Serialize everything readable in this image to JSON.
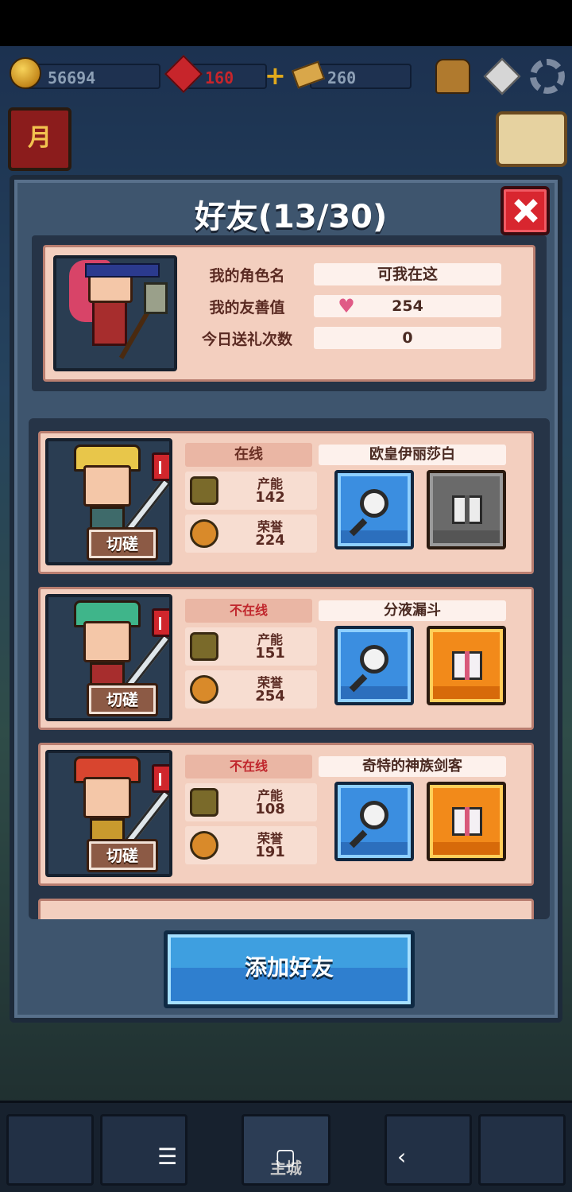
{
  "resources": {
    "gold": "56694",
    "gems": "160",
    "tickets": "260"
  },
  "dialog": {
    "title": "好友(13/30)"
  },
  "my_info": {
    "rows": [
      {
        "label": "我的角色名",
        "value": "可我在这"
      },
      {
        "label": "我的友善值",
        "value": "254"
      },
      {
        "label": "今日送礼次数",
        "value": "0"
      }
    ]
  },
  "friends": [
    {
      "status": "在线",
      "name": "欧皇伊丽莎白",
      "power_label": "产能",
      "power": "142",
      "honor_label": "荣誉",
      "honor": "224",
      "spar": "切磋",
      "gift_enabled": false
    },
    {
      "status": "不在线",
      "name": "分液漏斗",
      "power_label": "产能",
      "power": "151",
      "honor_label": "荣誉",
      "honor": "254",
      "spar": "切磋",
      "gift_enabled": true
    },
    {
      "status": "不在线",
      "name": "奇特的神族剑客",
      "power_label": "产能",
      "power": "108",
      "honor_label": "荣誉",
      "honor": "191",
      "spar": "切磋",
      "gift_enabled": true
    }
  ],
  "add_friend_label": "添加好友",
  "bottom_nav": {
    "main_city": "主城"
  },
  "colors": {
    "accent_blue": "#3b8ee0",
    "gift_orange": "#f28a1a",
    "close_red": "#d8262f",
    "offline_red": "#c0262c"
  }
}
